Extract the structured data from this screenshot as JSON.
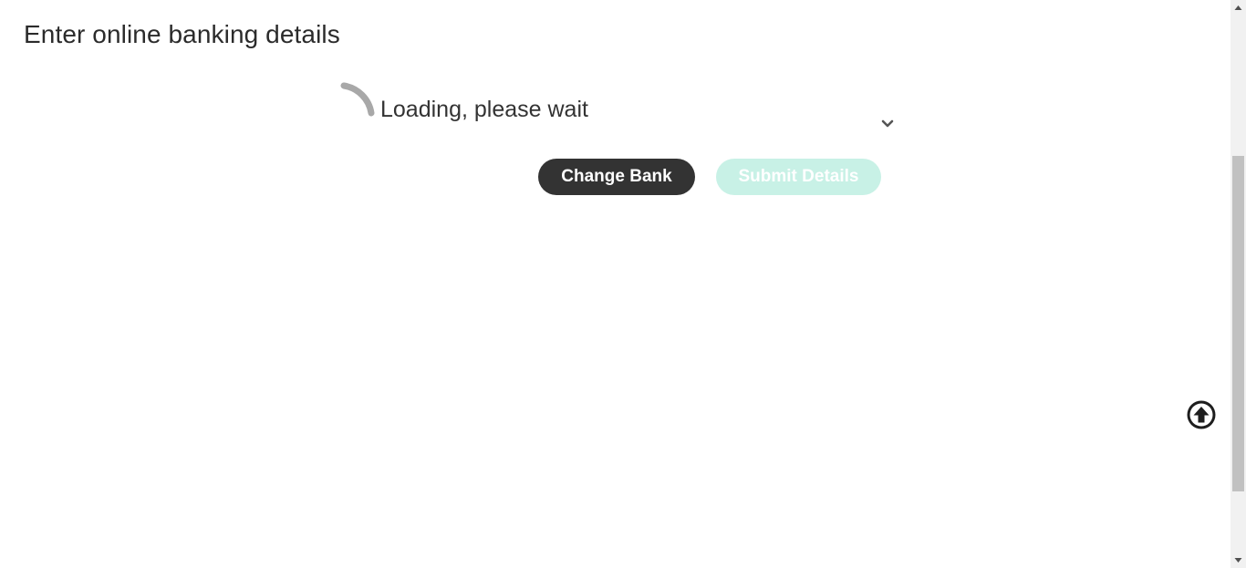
{
  "page": {
    "title": "Enter online banking details"
  },
  "loading": {
    "text": "Loading, please wait",
    "spinner_icon": "spinner-icon"
  },
  "select": {
    "chevron_icon": "chevron-down-icon"
  },
  "actions": {
    "change_bank_label": "Change Bank",
    "submit_label": "Submit Details",
    "submit_disabled": true
  },
  "scroll_top": {
    "icon": "arrow-up-circle-icon"
  },
  "colors": {
    "primary_dark": "#333333",
    "submit_disabled_bg": "#c8f1e6",
    "text": "#2b2b2b"
  }
}
